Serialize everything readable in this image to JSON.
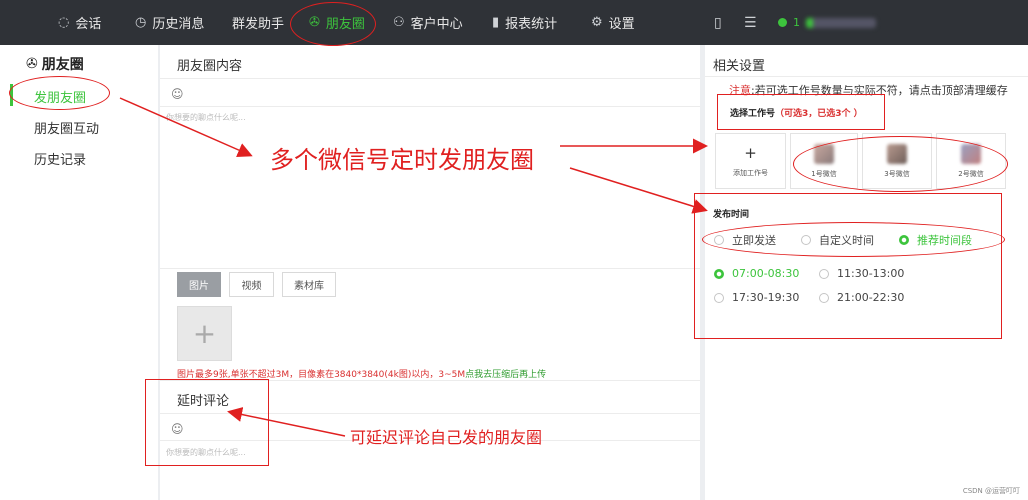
{
  "topbar": {
    "items": [
      {
        "icon": "chat-icon",
        "glyph": "💬",
        "label": "会话"
      },
      {
        "icon": "clock-icon",
        "glyph": "◷",
        "label": "历史消息"
      },
      {
        "icon": "",
        "glyph": "",
        "label": "群发助手"
      },
      {
        "icon": "aperture-icon",
        "glyph": "✇",
        "label": "朋友圈"
      },
      {
        "icon": "user-icon",
        "glyph": "☺",
        "label": "客户中心"
      },
      {
        "icon": "bar-chart-icon",
        "glyph": "▮",
        "label": "报表统计"
      },
      {
        "icon": "gear-icon",
        "glyph": "⚙",
        "label": "设置"
      }
    ],
    "user_prefix": "1"
  },
  "sidebar": {
    "title": "朋友圈",
    "items": [
      "发朋友圈",
      "朋友圈互动",
      "历史记录"
    ]
  },
  "main": {
    "content_title": "朋友圈内容",
    "placeholder": "你想要的聊点什么呢...",
    "tabs": [
      "图片",
      "视频",
      "素材库"
    ],
    "upload_hint_red": "图片最多9张,单张不超过3M，目像素在3840*3840(4k图)以内，3~5M",
    "upload_hint_green": "点我去压缩后再上传",
    "delay_title": "延时评论",
    "delay_placeholder": "你想要的聊点什么呢..."
  },
  "settings": {
    "title": "相关设置",
    "note_label": "注意",
    "note_text": ":若可选工作号数量与实际不符，请点击顶部清理缓存",
    "select_label": "选择工作号",
    "select_hint": "（可选3，已选3个 ）",
    "add_label": "添加工作号",
    "accounts": [
      "1号微信",
      "3号微信",
      "2号微信"
    ],
    "publish_time_label": "发布时间",
    "modes": [
      "立即发送",
      "自定义时间",
      "推荐时间段"
    ],
    "slots": [
      "07:00-08:30",
      "11:30-13:00",
      "17:30-19:30",
      "21:00-22:30"
    ]
  },
  "annotations": {
    "main": "多个微信号定时发朋友圈",
    "delay": "可延迟评论自己发的朋友圈"
  },
  "watermark": "CSDN @运营叮叮",
  "colors": {
    "accent": "#3dc43d",
    "annotation": "#e02020",
    "topbar": "#2f3237"
  }
}
